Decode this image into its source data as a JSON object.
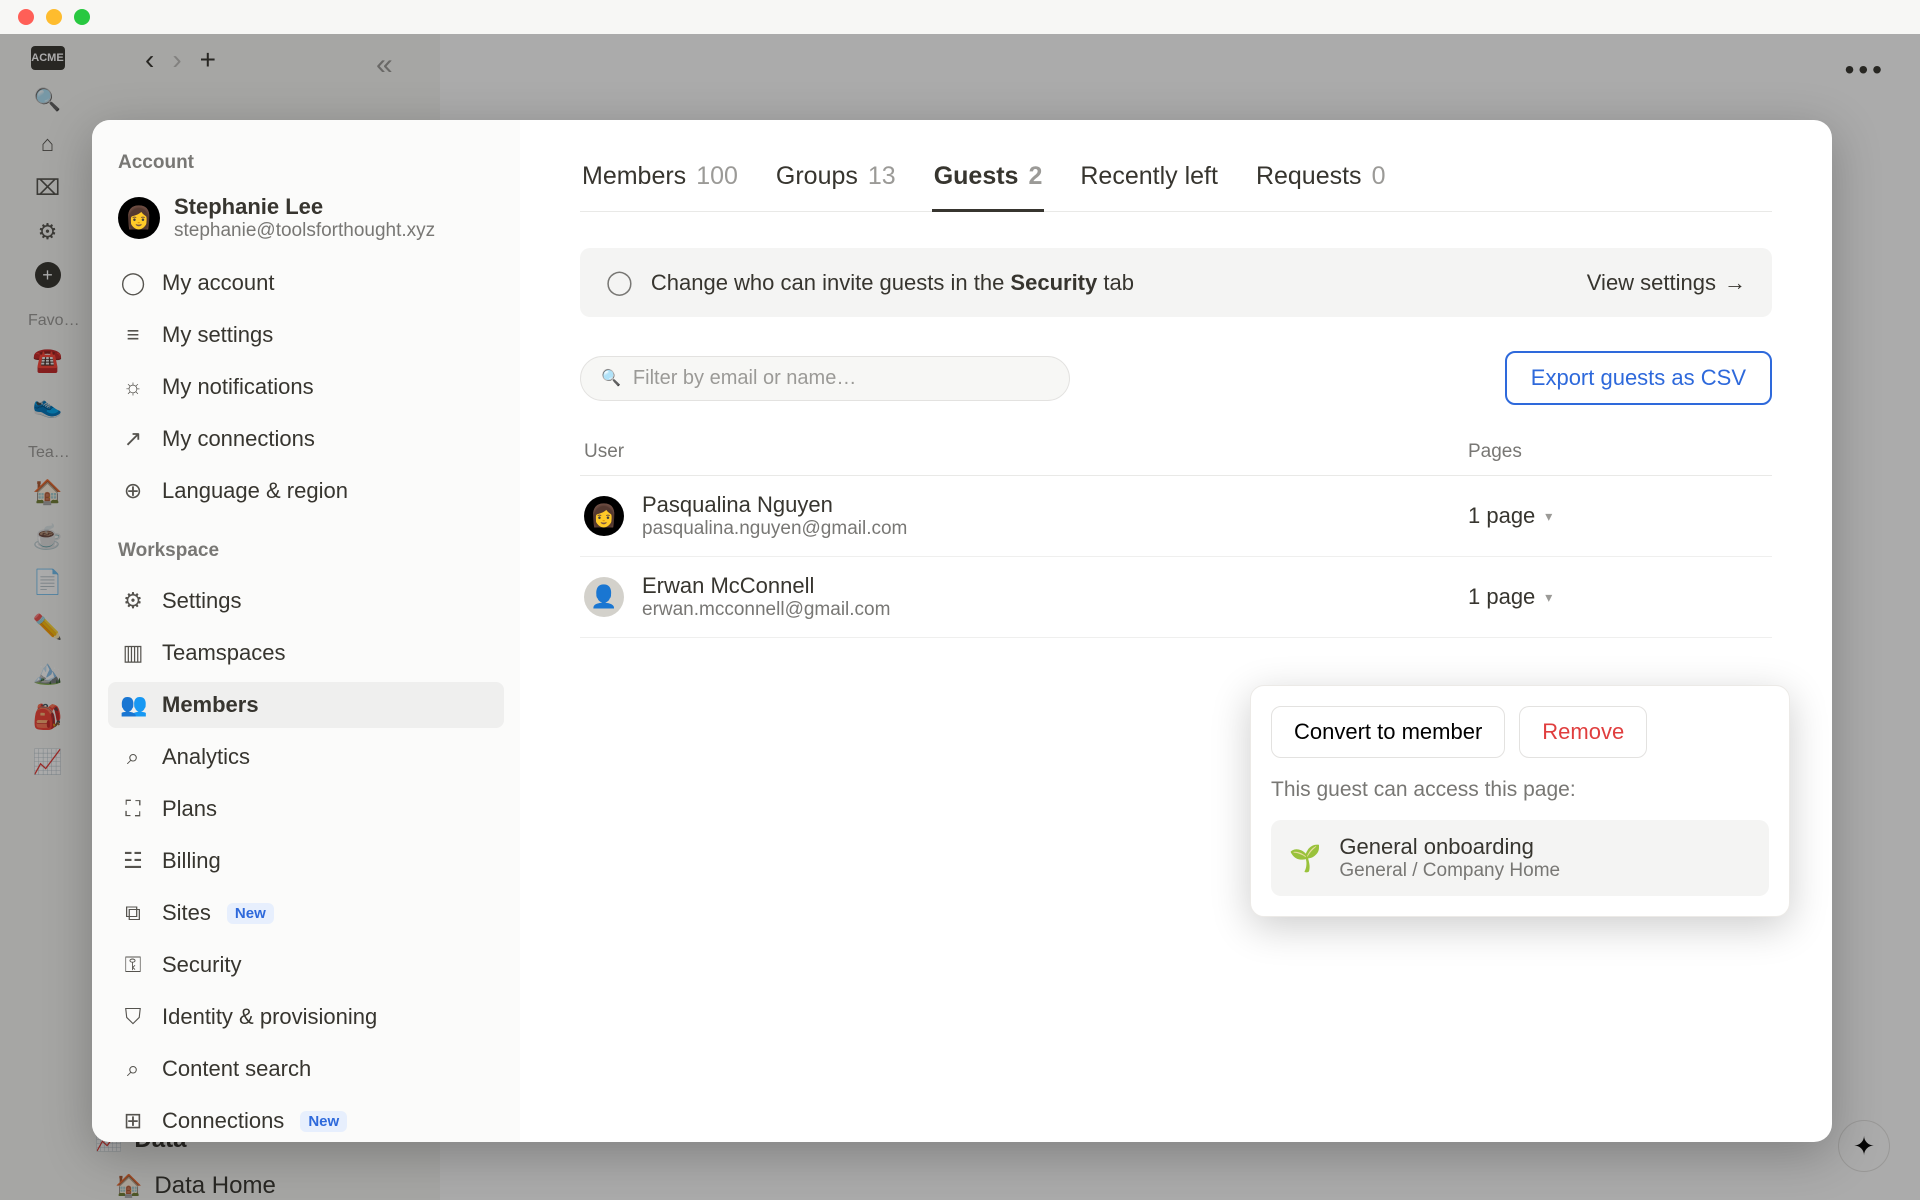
{
  "bg": {
    "acme_label": "ACME",
    "dots": 3,
    "collapse_glyph": "«",
    "nav_back": "‹",
    "nav_fwd": "›",
    "nav_plus": "+",
    "more": "•••",
    "sections": {
      "favorites": "Favo…",
      "teamspaces": "Tea…"
    },
    "emoji_items": [
      "☎️",
      "👟"
    ],
    "team_emoji_items": [
      "🏠",
      "☕️",
      "📄",
      "✏️",
      "🏔️",
      "🎒",
      "📈"
    ],
    "page_labels": [
      "Data",
      "Data Home"
    ],
    "page_label_emojis": [
      "📈",
      "🏠"
    ],
    "ai_icon": "✦"
  },
  "sidebar": {
    "section_account": "Account",
    "section_workspace": "Workspace",
    "user": {
      "name": "Stephanie Lee",
      "email": "stephanie@toolsforthought.xyz"
    },
    "items_account": [
      {
        "icon": "◯",
        "label": "My account"
      },
      {
        "icon": "≡",
        "label": "My settings"
      },
      {
        "icon": "☼",
        "label": "My notifications"
      },
      {
        "icon": "↗",
        "label": "My connections"
      },
      {
        "icon": "⊕",
        "label": "Language & region"
      }
    ],
    "items_workspace": [
      {
        "icon": "⚙",
        "label": "Settings"
      },
      {
        "icon": "▥",
        "label": "Teamspaces"
      },
      {
        "icon": "👥",
        "label": "Members",
        "active": true
      },
      {
        "icon": "⌕",
        "label": "Analytics"
      },
      {
        "icon": "⛶",
        "label": "Plans"
      },
      {
        "icon": "☳",
        "label": "Billing"
      },
      {
        "icon": "⧉",
        "label": "Sites",
        "badge": "New"
      },
      {
        "icon": "⚿",
        "label": "Security"
      },
      {
        "icon": "⛉",
        "label": "Identity & provisioning"
      },
      {
        "icon": "⌕",
        "label": "Content search"
      },
      {
        "icon": "⊞",
        "label": "Connections",
        "badge": "New"
      }
    ]
  },
  "panel": {
    "tabs": [
      {
        "label": "Members",
        "count": "100"
      },
      {
        "label": "Groups",
        "count": "13"
      },
      {
        "label": "Guests",
        "count": "2",
        "active": true
      },
      {
        "label": "Recently left",
        "count": ""
      },
      {
        "label": "Requests",
        "count": "0"
      }
    ],
    "banner_pre": "Change who can invite guests in the ",
    "banner_bold": "Security",
    "banner_post": " tab",
    "banner_link": "View settings",
    "search_placeholder": "Filter by email or name…",
    "export_label": "Export guests as CSV",
    "col_user": "User",
    "col_pages": "Pages",
    "guests": [
      {
        "name": "Pasqualina Nguyen",
        "email": "pasqualina.nguyen@gmail.com",
        "pages": "1 page",
        "avatar": "dark"
      },
      {
        "name": "Erwan McConnell",
        "email": "erwan.mcconnell@gmail.com",
        "pages": "1 page",
        "avatar": "gray"
      }
    ]
  },
  "popover": {
    "convert": "Convert to member",
    "remove": "Remove",
    "note": "This guest can access this page:",
    "page_emoji": "🌱",
    "page_title": "General onboarding",
    "page_path": "General / Company Home"
  }
}
